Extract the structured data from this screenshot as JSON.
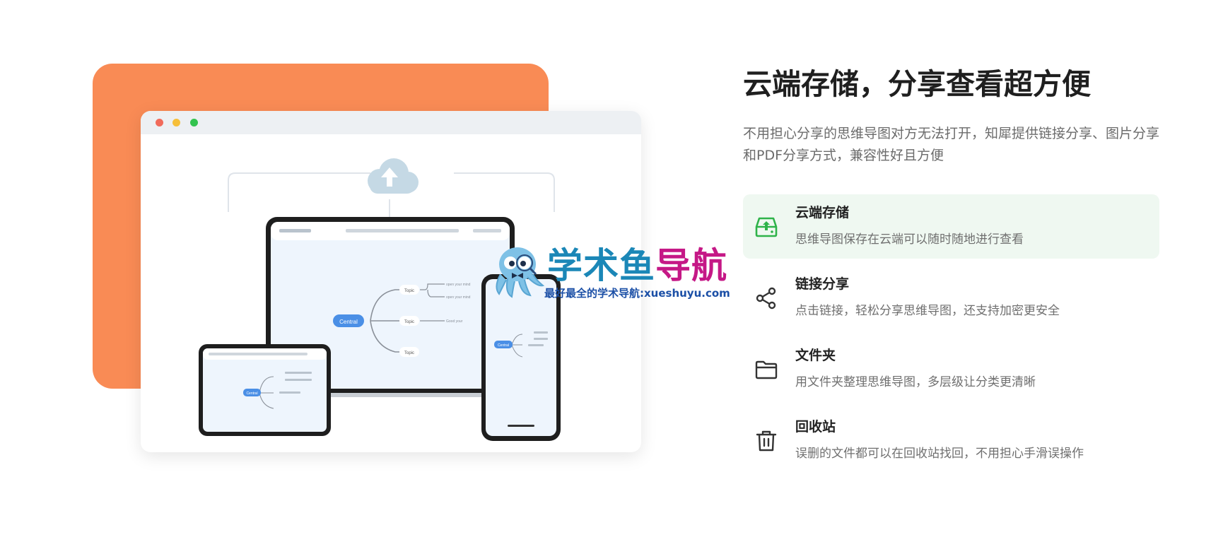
{
  "illustration": {
    "mindmap": {
      "center": "Central",
      "topics": [
        "Topic",
        "Topic",
        "Topic"
      ],
      "sub_topics": [
        "open your mind",
        "open your mind",
        "Good your"
      ]
    }
  },
  "watermark": {
    "title_part1": "学术鱼",
    "title_part2": "导航",
    "subtitle": "最好最全的学术导航:xueshuyu.com"
  },
  "section": {
    "headline": "云端存储，分享查看超方便",
    "intro": "不用担心分享的思维导图对方无法打开，知犀提供链接分享、图片分享和PDF分享方式，兼容性好且方便"
  },
  "features": [
    {
      "icon": "cloud-drive-icon",
      "title": "云端存储",
      "desc": "思维导图保存在云端可以随时随地进行查看",
      "active": true
    },
    {
      "icon": "share-icon",
      "title": "链接分享",
      "desc": "点击链接，轻松分享思维导图，还支持加密更安全",
      "active": false
    },
    {
      "icon": "folder-icon",
      "title": "文件夹",
      "desc": "用文件夹整理思维导图，多层级让分类更清晰",
      "active": false
    },
    {
      "icon": "trash-icon",
      "title": "回收站",
      "desc": "误删的文件都可以在回收站找回，不用担心手滑误操作",
      "active": false
    }
  ],
  "colors": {
    "orange": "#f98b55",
    "active_green": "#2fb34a",
    "active_bg": "#eff8f1",
    "central_node": "#4a8fe6",
    "watermark_blue": "#1b87b7",
    "watermark_pink": "#c51886"
  }
}
